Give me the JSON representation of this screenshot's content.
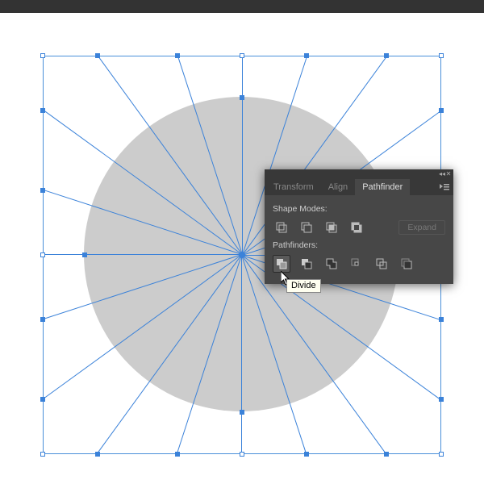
{
  "panel": {
    "tabs": {
      "transform": "Transform",
      "align": "Align",
      "pathfinder": "Pathfinder"
    },
    "shape_modes_label": "Shape Modes:",
    "pathfinders_label": "Pathfinders:",
    "expand_label": "Expand",
    "tooltip": "Divide",
    "icons": {
      "collapse": "◂◂",
      "close": "✕",
      "menu": "▾≡"
    }
  },
  "canvas": {
    "spokes": 20,
    "selection_color": "#3b82d9",
    "circle_fill": "#cccccc"
  }
}
